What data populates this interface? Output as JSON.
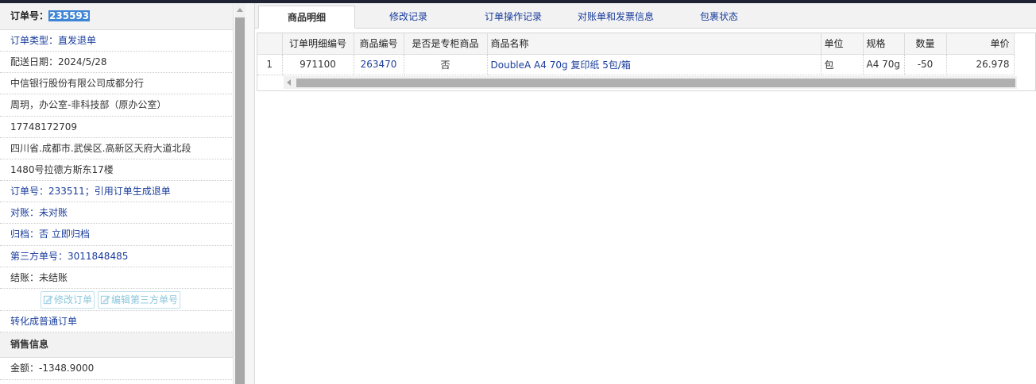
{
  "order": {
    "number_label": "订单号：",
    "number_value": "235593",
    "type": "订单类型：直发退单",
    "delivery_date": "配送日期：2024/5/28",
    "company": "中信银行股份有限公司成都分行",
    "contact": "周玥，办公室-非科技部（原办公室）",
    "phone": "17748172709",
    "address_line1": "四川省.成都市.武侯区.高新区天府大道北段",
    "address_line2": "1480号拉德方斯东17楼",
    "ref_order": "订单号：233511；引用订单生成退单",
    "reconcile": "对账：未对账",
    "archive": "归档：否 立即归档",
    "third_party": "第三方单号：3011848485",
    "settlement": "结账：未结账",
    "edit_order_btn": "修改订单",
    "edit_third_party_btn": "编辑第三方单号",
    "convert_link": "转化成普通订单"
  },
  "sales": {
    "title": "销售信息",
    "amount": "金额：-1348.9000"
  },
  "tabs": [
    {
      "label": "商品明细",
      "active": true
    },
    {
      "label": "修改记录",
      "active": false
    },
    {
      "label": "订单操作记录",
      "active": false
    },
    {
      "label": "对账单和发票信息",
      "active": false
    },
    {
      "label": "包裹状态",
      "active": false
    }
  ],
  "grid": {
    "columns": [
      "",
      "订单明细编号",
      "商品编号",
      "是否是专柜商品",
      "商品名称",
      "单位",
      "规格",
      "数量",
      "单价"
    ],
    "rows": [
      [
        "1",
        "971100",
        "263470",
        "否",
        "DoubleA A4 70g 复印纸 5包/箱",
        "包",
        "A4 70g",
        "-50",
        "26.978"
      ]
    ]
  },
  "colors": {
    "link": "#1a3d9c",
    "selection": "#3f85d6",
    "header_bg": "#f2f2f2"
  }
}
